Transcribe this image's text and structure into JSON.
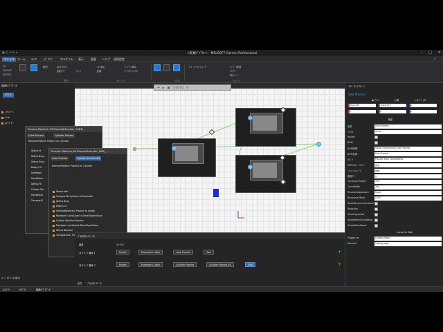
{
  "window": {
    "title": "<新規ﾊﾟｲｱｳﾄ> - MELSOFT Gemini Professional",
    "quick_access": "▣ ◫ ⟲ ⟳ ▾"
  },
  "menu": [
    "ファイル",
    "ホーム",
    "ｽﾃｲﾂ",
    "ﾓﾃﾞﾘﾝｸﾞ",
    "プログラム",
    "表示",
    "画面",
    "ヘルプ",
    "接続設定"
  ],
  "ribbon": {
    "items": [
      "3D",
      "2D/CAD",
      "2D/SSD",
      "範囲",
      "拡大ボタン",
      "起動ｻｲﾄﾞ",
      "ｽﾅｯﾌﾟ",
      "ｶﾒﾗ補足",
      "距離",
      "ｸﾞﾙｰﾌﾟ解除",
      "ﾀﾞｲｱﾛｸﾞのｸﾘｱ",
      "ｺﾝﾎﾟｰﾈﾝﾄのﾏｯﾋﾟﾝｸﾞ",
      "ｳｨﾝﾄﾞｳ配置",
      "ﾚｲｱｳﾄ",
      "表示ﾓｰﾄﾞ"
    ],
    "groups": [
      "表示",
      "ﾍﾙﾊﾟｰﾂｰﾙ",
      "ﾍﾙﾊﾟｰﾂｰﾙ",
      "ﾏﾃﾘｱﾙ",
      "ｳｨﾝﾄﾞｳ"
    ]
  },
  "left": {
    "title": "製品ﾀｲﾌﾟｴﾃﾞｨﾀ",
    "button": "すべて",
    "items": [
      "ﾌﾛｰｽﾃｰｼﾞ",
      "Cub",
      "ｽﾀｰｸﾞﾙｰ"
    ],
    "checkbox_label": "ﾌﾟﾛﾊﾟﾃｨの表示",
    "tabs": [
      "ﾈｯﾄﾜｰｸ",
      "ｾﾙｸﾞﾗﾌ",
      "製品ﾀｲﾌﾟｴﾃﾞｨﾀ"
    ]
  },
  "playbar": {
    "time": "0:00:00"
  },
  "panel_a": {
    "title": "Process Machine #3:ProcessExecutor...HIDE...",
    "tabs": [
      "Cube Process",
      "Cylinder Process"
    ],
    "rows": [
      "RemoveProduct: Product on Cylinder"
    ],
    "side_rows": [
      "Status Id",
      "Status Busy",
      "Status Error",
      "Delays Ta",
      "SetModel",
      "MoveBlock",
      "Debug Ta",
      "Custom Ma",
      "MoveBlock",
      "TransportP"
    ]
  },
  "panel_b": {
    "title": "Process Machine #2:ProcessExecutor_HIDE_...",
    "tabs": [
      "Cube Process",
      "Cylinder Process #2"
    ],
    "rows": [
      "RemoveProduct: Product on Cylinder"
    ],
    "list": [
      "Status Idle",
      "TransportTo Cylinder at Productfn",
      "Status Busy",
      "Delays 1s",
      "SetNodeMaterial: Product fn yellow",
      "MoveJoint: JointClose to DecelObjectValue",
      "Custom Machine Process",
      "MoveJoint: JointScore DecelOpenValue",
      "Status Blocked",
      "TransportOut: Productfn"
    ]
  },
  "proc": {
    "title": "ﾌﾟﾛｾｽﾌﾛｰｴﾃﾞｨﾀ",
    "col1": "製品",
    "col2": "ﾌﾛｰｽﾃｯﾌﾟ",
    "row1_label": "ﾌﾛｰｸﾞﾙｰﾌﾟ番号 1",
    "row1_chips": [
      "Feeder",
      "Parametric Lathe",
      "cube Process",
      "Sink"
    ],
    "row2_label": "ｽﾀｰｸﾞﾙｰﾌﾟ番号 2",
    "row2_chips": [
      "Feeder",
      "Parametric Lathe",
      "Cylinder Process",
      "Cylinder Process #2",
      "Sink"
    ]
  },
  "bottom_tabs": [
    "出力",
    "ﾌﾟﾛｾｽﾌﾛｰｴﾃﾞｨﾀ"
  ],
  "right": {
    "title": "ｺﾝﾎﾟｰﾈﾝﾄﾌﾟﾛﾊﾟﾃｨ",
    "component": "Sink Process",
    "coord_modes": [
      "ﾜｰﾙﾄﾞ",
      "親",
      "ｵﾌﾞｼﾞｪｸﾄ"
    ],
    "xyz": [
      "2004.487",
      "-3465.475",
      "0"
    ],
    "xyz2": [
      "0",
      "0",
      "0"
    ],
    "section": "既定",
    "props": [
      {
        "label": "名前",
        "value": "Sink Process"
      },
      {
        "label": "ﾏﾃﾘｱﾙ",
        "value": "white"
      },
      {
        "label": "Visible",
        "check": "✓"
      },
      {
        "label": "BOM",
        "check": "✓"
      },
      {
        "label": "BOM説明",
        "value": "Visual Components Sink Process"
      },
      {
        "label": "BOM名称",
        "value": "Sink Process"
      },
      {
        "label": "ｶﾃｺﾞﾘ",
        "value": "Process Flow Components"
      },
      {
        "label": "PDFｴｸｽﾎﾟｰﾄﾚﾍﾞﾙ",
        "value": "完全"
      },
      {
        "label": "ｼﾐｭﾚｰｼｮﾝﾚﾍﾞﾙ",
        "value": "詳細"
      },
      {
        "label": "衝突ﾓｰﾄﾞ",
        "value": "ｵﾝ"
      },
      {
        "label": "ConveyorHeight",
        "value": "700"
      },
      {
        "label": "ConvWidth",
        "value": "200"
      },
      {
        "label": "ResourceApproach",
        "value": "Right"
      },
      {
        "label": "ResourceOffset",
        "value": "0      0      0"
      },
      {
        "label": "ShowResourceLocation",
        "check": "✓"
      },
      {
        "label": "ShowSim",
        "check": "✓"
      },
      {
        "label": "AutoProperties",
        "check": "✓"
      },
      {
        "label": "ShowWhenSimulating",
        "check": "✓"
      },
      {
        "label": "ShowWhenReset",
        "check": "✓"
      }
    ],
    "path_section": "Curve On Path",
    "path_props": [
      {
        "label": "Trigger de",
        "value": "Leading Edge"
      },
      {
        "label": "Resolhd",
        "value": "Trailing edge"
      }
    ]
  }
}
